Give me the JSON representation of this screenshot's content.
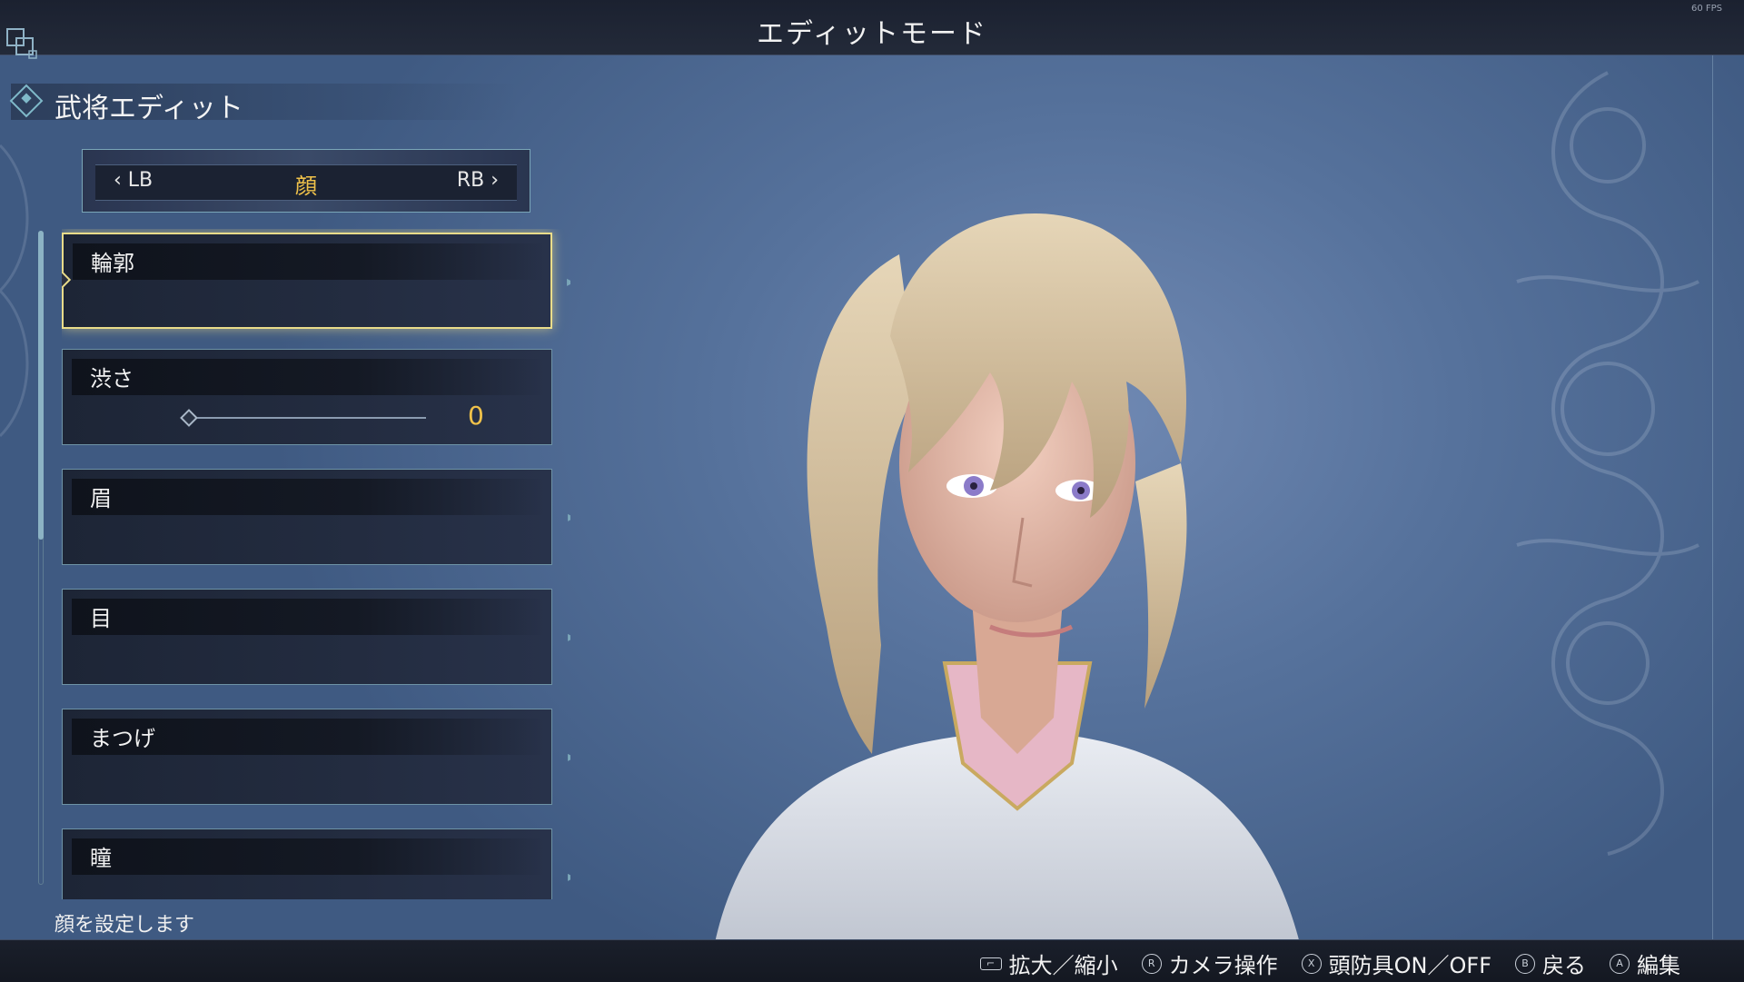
{
  "header": {
    "title": "エディットモード",
    "fps": "60 FPS"
  },
  "section": {
    "title": "武将エディット"
  },
  "tabs": {
    "prev": "‹ LB",
    "current": "顔",
    "next": "RB ›"
  },
  "options": [
    {
      "label": "輪郭",
      "selected": true
    },
    {
      "label": "渋さ",
      "slider_value": "0",
      "slider_fraction": 0
    },
    {
      "label": "眉"
    },
    {
      "label": "目"
    },
    {
      "label": "まつげ"
    },
    {
      "label": "瞳"
    }
  ],
  "help_text": "顔を設定します",
  "button_hints": [
    {
      "glyph": "⌐",
      "label": "拡大／縮小",
      "icon": "right-stick-icon"
    },
    {
      "glyph": "R",
      "label": "カメラ操作",
      "icon": "r-button-icon"
    },
    {
      "glyph": "X",
      "label": "頭防具ON／OFF",
      "icon": "x-button-icon"
    },
    {
      "glyph": "B",
      "label": "戻る",
      "icon": "b-button-icon"
    },
    {
      "glyph": "A",
      "label": "編集",
      "icon": "a-button-icon"
    }
  ],
  "colors": {
    "accent_gold": "#f0c24a",
    "selected_border": "#e9dc8a",
    "frame_cyan": "#7aa6b8"
  }
}
